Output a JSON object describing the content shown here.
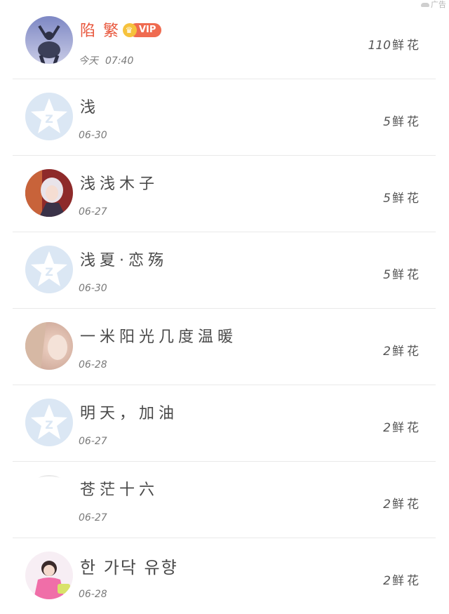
{
  "ad_label": "广告",
  "rows": [
    {
      "name": "陷 繁",
      "date_label": "今天",
      "date": "07:40",
      "flowers": "110",
      "unit": "鲜花",
      "vip": true,
      "vip_text": "VIP",
      "avatar": "photo-figure"
    },
    {
      "name": "浅",
      "date": "06-30",
      "flowers": "5",
      "unit": "鲜花",
      "avatar": "qq-default"
    },
    {
      "name": "浅浅木子",
      "date": "06-27",
      "flowers": "5",
      "unit": "鲜花",
      "avatar": "photo-anime"
    },
    {
      "name": "浅夏·恋殇",
      "date": "06-30",
      "flowers": "5",
      "unit": "鲜花",
      "avatar": "qq-default"
    },
    {
      "name": "一米阳光几度温暖",
      "date": "06-28",
      "flowers": "2",
      "unit": "鲜花",
      "avatar": "photo-girl"
    },
    {
      "name": "明天，加油",
      "date": "06-27",
      "flowers": "2",
      "unit": "鲜花",
      "avatar": "qq-default"
    },
    {
      "name": "苍茫十六",
      "date": "06-27",
      "flowers": "2",
      "unit": "鲜花",
      "avatar": "blank"
    },
    {
      "name": "한 가닥 유향",
      "date": "06-28",
      "flowers": "2",
      "unit": "鲜花",
      "avatar": "photo-pink"
    }
  ],
  "colors": {
    "vip_badge": "#ef6b50",
    "crown": "#f6c23c",
    "vip_name": "#e8573d",
    "qq_avatar_bg": "#dbe7f4"
  }
}
